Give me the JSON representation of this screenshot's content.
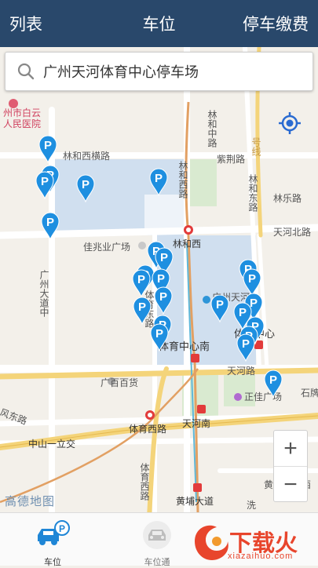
{
  "header": {
    "left_label": "列表",
    "title": "车位",
    "right_label": "停车缴费"
  },
  "search": {
    "text": "广州天河体育中心停车场",
    "icon": "search-icon"
  },
  "map": {
    "labels": {
      "baiyun_hosp_1": "州市白云",
      "baiyun_hosp_2": "人民医院",
      "linhe_zhong": "林和中路",
      "linhe_xiheng": "林和西横路",
      "linhe_xilu": "林和西路",
      "zihe": "紫荆路",
      "linle": "林乐路",
      "linhe_dong": "林和东路",
      "tianhe_bei": "天河北路",
      "linhexi": "林和西",
      "jiazhaoye": "佳兆业广场",
      "guangzhou_tianhe_1": "广州天河",
      "tiyu_zhongxin": "体育中心",
      "tiyu_zhongxin_nan": "体育中心南",
      "guangzhou_dadaozhong": "广州大道中",
      "tiyu_donglu": "体育东路",
      "tianhe_lu": "天河路",
      "guangbai": "广百百货",
      "zhengjia": "正佳广场",
      "shipai": "石牌",
      "feng_dong": "风东路",
      "tiyu_xi": "体育西路",
      "tianhe_nan": "天河南",
      "zhongshan_yili": "中山一立交",
      "huangpu_dadao": "黄埔大道",
      "huangpu_west": "黄埔大道西",
      "tiyuxi_v": "体育西路",
      "xi": "洗",
      "hao": "号线"
    },
    "brand": "高德地图",
    "zoom_in": "+",
    "zoom_out": "−"
  },
  "tabs": [
    {
      "label": "车位",
      "icon": "parking-car-icon"
    },
    {
      "label": "车位通",
      "icon": "car-front-icon"
    }
  ],
  "watermark": {
    "text": "下载火",
    "sub": "xiazaihuo.com"
  },
  "colors": {
    "header_bg": "#29486b",
    "pin": "#1e8fe0",
    "area": "#c9dcf0",
    "accent": "#e8452c"
  }
}
